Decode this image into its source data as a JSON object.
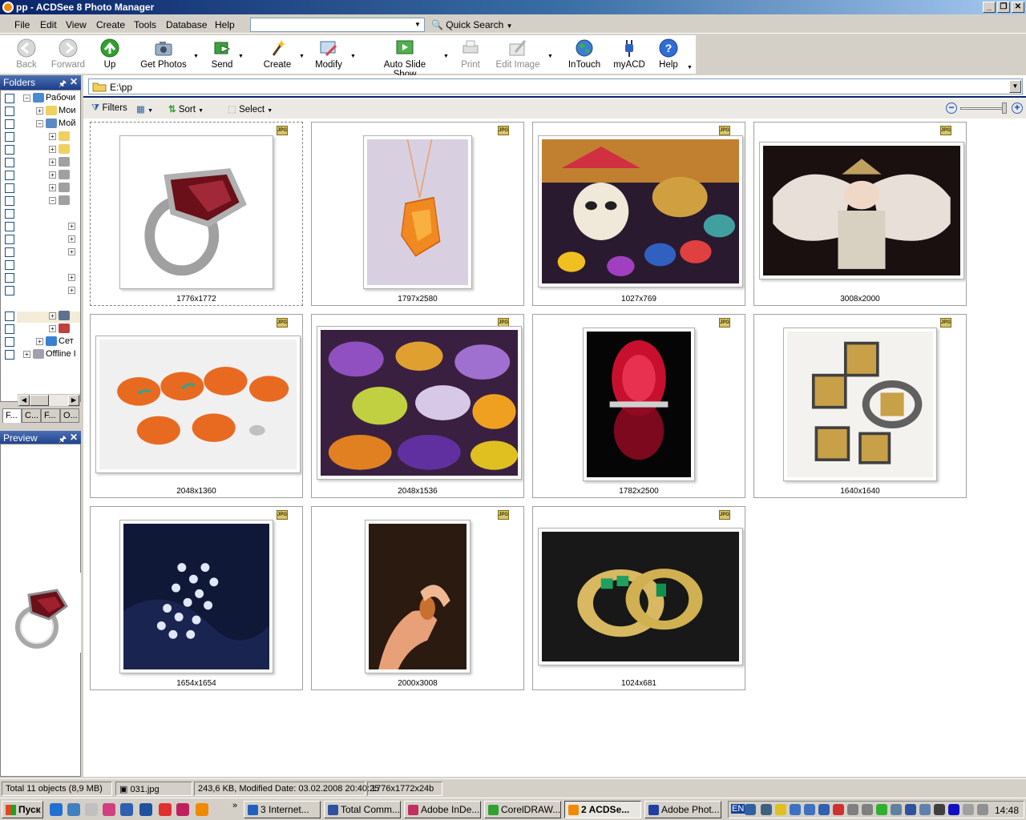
{
  "window": {
    "title": "pp - ACDSee 8 Photo Manager"
  },
  "menu": [
    "File",
    "Edit",
    "View",
    "Create",
    "Tools",
    "Database",
    "Help"
  ],
  "quick_search": {
    "label": "Quick Search",
    "value": ""
  },
  "toolbar": [
    {
      "label": "Back",
      "icon": "back-icon",
      "enabled": false
    },
    {
      "label": "Forward",
      "icon": "forward-icon",
      "enabled": false
    },
    {
      "label": "Up",
      "icon": "up-arrow-icon",
      "enabled": true
    },
    {
      "label": "Get Photos",
      "icon": "camera-icon",
      "enabled": true
    },
    {
      "label": "Send",
      "icon": "send-icon",
      "enabled": true
    },
    {
      "label": "Create",
      "icon": "wand-icon",
      "enabled": true
    },
    {
      "label": "Modify",
      "icon": "modify-icon",
      "enabled": true
    },
    {
      "label": "Auto Slide Show",
      "icon": "slideshow-icon",
      "enabled": true
    },
    {
      "label": "Print",
      "icon": "printer-icon",
      "enabled": false
    },
    {
      "label": "Edit Image",
      "icon": "edit-image-icon",
      "enabled": false
    },
    {
      "label": "InTouch",
      "icon": "globe-icon",
      "enabled": true
    },
    {
      "label": "myACD",
      "icon": "plug-icon",
      "enabled": true
    },
    {
      "label": "Help",
      "icon": "help-icon",
      "enabled": true
    }
  ],
  "folders_pane": {
    "title": "Folders",
    "tree": [
      {
        "label": "Рабочи",
        "icon": "desktop-icon"
      },
      {
        "label": "Мои",
        "icon": "folder-icon"
      },
      {
        "label": "Мой",
        "icon": "computer-icon"
      },
      {
        "label": "",
        "icon": "folder-icon"
      },
      {
        "label": "",
        "icon": "folder-icon"
      },
      {
        "label": "",
        "icon": "drive-icon"
      },
      {
        "label": "",
        "icon": "drive-icon"
      },
      {
        "label": "",
        "icon": "drive-icon"
      },
      {
        "label": "",
        "icon": "drive-icon"
      },
      {
        "label": "",
        "icon": ""
      },
      {
        "label": "",
        "icon": ""
      },
      {
        "label": "",
        "icon": ""
      },
      {
        "label": "",
        "icon": ""
      },
      {
        "label": "",
        "icon": ""
      },
      {
        "label": "",
        "icon": ""
      },
      {
        "label": "",
        "icon": ""
      },
      {
        "label": "",
        "icon": "control-panel-icon"
      },
      {
        "label": "",
        "icon": "documents-icon"
      },
      {
        "label": "Сет",
        "icon": "network-icon"
      },
      {
        "label": "Offline I",
        "icon": "offline-icon"
      }
    ],
    "tabs": [
      "F...",
      "C...",
      "F...",
      "O..."
    ]
  },
  "preview_pane": {
    "title": "Preview"
  },
  "path": "E:\\pp",
  "filter_bar": {
    "filters": "Filters",
    "sort": "Sort",
    "select": "Select"
  },
  "thumbnails": [
    {
      "dims": "1776x1772",
      "type": "JPG",
      "subject": "ring"
    },
    {
      "dims": "1797x2580",
      "type": "JPG",
      "subject": "pendant"
    },
    {
      "dims": "1027x769",
      "type": "JPG",
      "subject": "masks"
    },
    {
      "dims": "3008x2000",
      "type": "JPG",
      "subject": "angel"
    },
    {
      "dims": "2048x1360",
      "type": "JPG",
      "subject": "beads"
    },
    {
      "dims": "2048x1536",
      "type": "JPG",
      "subject": "gems"
    },
    {
      "dims": "1782x2500",
      "type": "JPG",
      "subject": "ruby-ring"
    },
    {
      "dims": "1640x1640",
      "type": "JPG",
      "subject": "jewelry-set"
    },
    {
      "dims": "1654x1654",
      "type": "JPG",
      "subject": "crystals"
    },
    {
      "dims": "2000x3008",
      "type": "JPG",
      "subject": "hand-gem"
    },
    {
      "dims": "1024x681",
      "type": "JPG",
      "subject": "earrings"
    }
  ],
  "status": {
    "total": "Total 11 objects  (8,9 MB)",
    "file": "031.jpg",
    "info": "243,6 KB, Modified Date: 03.02.2008 20:40:25",
    "dims": "1776x1772x24b"
  },
  "taskbar": {
    "start": "Пуск",
    "tasks": [
      {
        "label": "3 Internet...",
        "color": "#2060c0"
      },
      {
        "label": "Total Comm...",
        "color": "#3050a0"
      },
      {
        "label": "Adobe InDe...",
        "color": "#c03060"
      },
      {
        "label": "CorelDRAW...",
        "color": "#30a030"
      },
      {
        "label": "2 ACDSe...",
        "color": "#f08a00"
      },
      {
        "label": "Adobe Phot...",
        "color": "#2040a0"
      }
    ],
    "lang": "EN",
    "clock": "14:48"
  },
  "colors": {
    "title_bar": "#0a246a",
    "selection": "#0a246a"
  }
}
